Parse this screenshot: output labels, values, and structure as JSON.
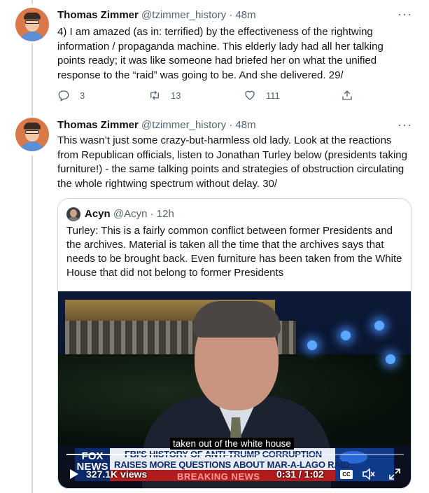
{
  "tweets": [
    {
      "author_name": "Thomas Zimmer",
      "handle": "@tzimmer_history",
      "separator": "·",
      "time": "48m",
      "more": "···",
      "text": "4) I am amazed (as in: terrified) by the effectiveness of the rightwing information / propaganda machine. This elderly lady had all her talking points ready; it was like someone had briefed her on what the unified response to the “raid” was going to be. And she delivered. 29/",
      "reply_count": "3",
      "retweet_count": "13",
      "like_count": "111"
    },
    {
      "author_name": "Thomas Zimmer",
      "handle": "@tzimmer_history",
      "separator": "·",
      "time": "48m",
      "more": "···",
      "text": "This wasn’t just some crazy-but-harmless old lady. Look at the reactions from Republican officials, listen to Jonathan Turley below (presidents taking furniture!) - the same talking points and strategies of obstruction circulating the whole rightwing spectrum without delay. 30/"
    }
  ],
  "quote": {
    "author_name": "Acyn",
    "handle": "@Acyn",
    "separator": "·",
    "time": "12h",
    "text": "Turley: This is a fairly common conflict between former Presidents and the archives. Material is taken all the time that the archives says that needs to be brought back. Even furniture has been taken from the White House that did not belong to former Presidents",
    "video": {
      "caption": "taken out of the white house",
      "headline_line1": "FBI'S HISTORY OF ANTI-TRUMP CORRUPTION",
      "headline_line2": "RAISES MORE QUESTIONS ABOUT MAR-A-LAGO RAID",
      "breaking_label": "BREAKING NEWS",
      "network_logo": "FOX NEWS",
      "show_logo": "Hannity",
      "views": "327.1K views",
      "timecode": "0:31 / 1:02",
      "progress": 0.5,
      "cc_label": "CC"
    }
  },
  "colors": {
    "text_primary": "#0f1419",
    "text_secondary": "#536471",
    "border": "#cfd9de",
    "avatar_bg": "#d9794a"
  },
  "icons": {
    "reply": "reply-icon",
    "retweet": "retweet-icon",
    "like": "heart-icon",
    "share": "share-icon",
    "play": "play-icon",
    "mute": "mute-icon",
    "expand": "expand-icon"
  }
}
